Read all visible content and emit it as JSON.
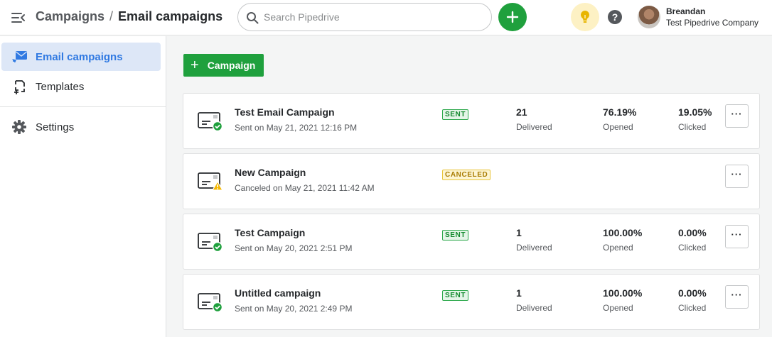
{
  "header": {
    "breadcrumb_parent": "Campaigns",
    "breadcrumb_separator": "/",
    "breadcrumb_current": "Email campaigns",
    "search_placeholder": "Search Pipedrive",
    "user_name": "Breandan",
    "user_company": "Test Pipedrive Company",
    "icons": [
      "menu-collapse-icon",
      "search-icon",
      "plus-icon",
      "lightbulb-icon",
      "help-icon"
    ]
  },
  "sidebar": {
    "items": [
      {
        "label": "Email campaigns",
        "icon": "email-campaign-icon",
        "active": true
      },
      {
        "label": "Templates",
        "icon": "templates-icon",
        "active": false
      },
      {
        "label": "Settings",
        "icon": "gear-icon",
        "active": false
      }
    ]
  },
  "main": {
    "new_campaign_label": "Campaign",
    "campaigns": [
      {
        "title": "Test Email Campaign",
        "subtitle": "Sent on May 21, 2021 12:16 PM",
        "status": "SENT",
        "delivered_value": "21",
        "delivered_label": "Delivered",
        "opened_value": "76.19%",
        "opened_label": "Opened",
        "clicked_value": "19.05%",
        "clicked_label": "Clicked",
        "more": "···"
      },
      {
        "title": "New Campaign",
        "subtitle": "Canceled on May 21, 2021 11:42 AM",
        "status": "CANCELED",
        "more": "···"
      },
      {
        "title": "Test Campaign",
        "subtitle": "Sent on May 20, 2021 2:51 PM",
        "status": "SENT",
        "delivered_value": "1",
        "delivered_label": "Delivered",
        "opened_value": "100.00%",
        "opened_label": "Opened",
        "clicked_value": "0.00%",
        "clicked_label": "Clicked",
        "more": "···"
      },
      {
        "title": "Untitled campaign",
        "subtitle": "Sent on May 20, 2021 2:49 PM",
        "status": "SENT",
        "delivered_value": "1",
        "delivered_label": "Delivered",
        "opened_value": "100.00%",
        "opened_label": "Opened",
        "clicked_value": "0.00%",
        "clicked_label": "Clicked",
        "more": "···"
      }
    ]
  },
  "colors": {
    "brand_green": "#1fa03d",
    "active_blue": "#317ae2",
    "active_bg": "#dde7f7",
    "sent_green": "#148a2f",
    "canceled_yellow": "#e8c53b"
  }
}
